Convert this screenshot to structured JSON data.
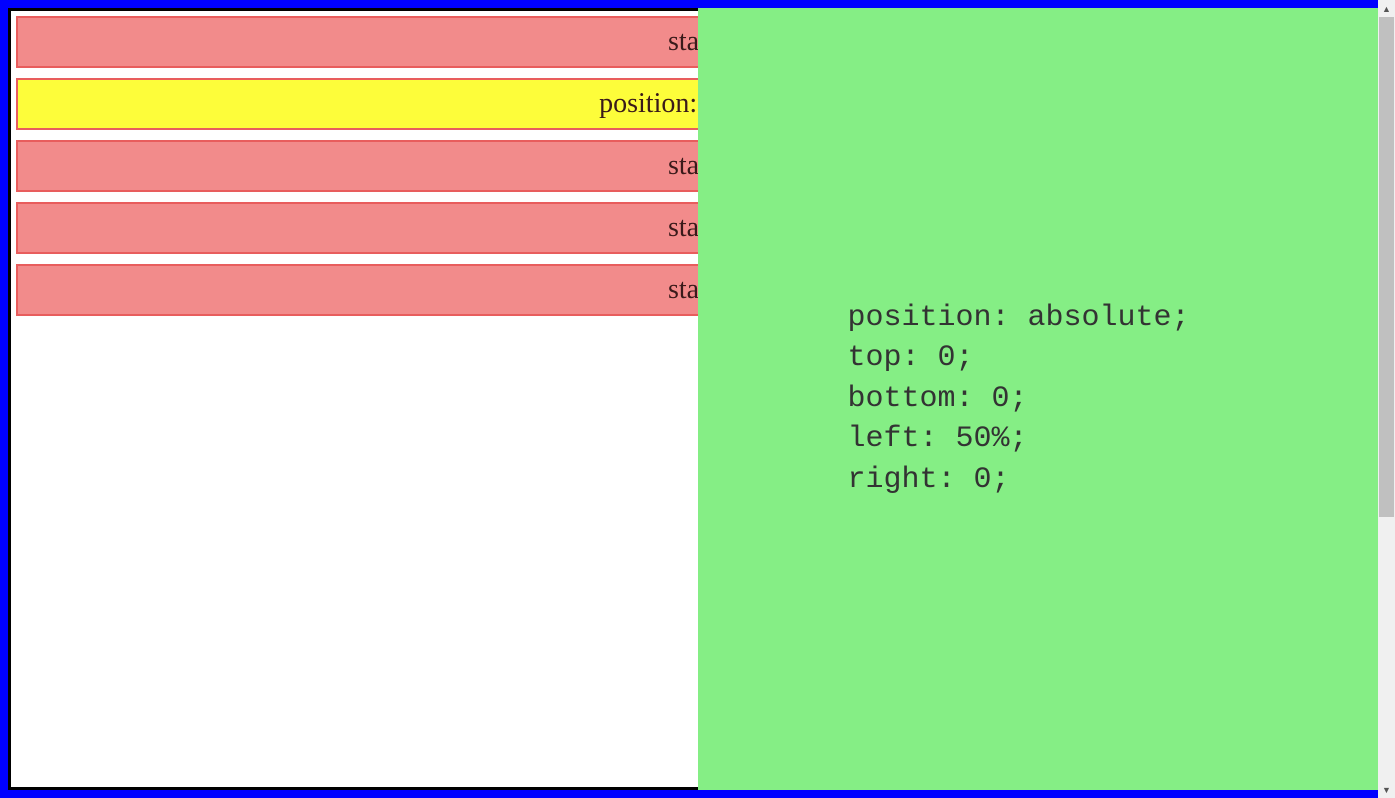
{
  "boxes": {
    "item0": "static",
    "item1": "position: relative;",
    "item2": "static",
    "item3": "static",
    "item4": "static"
  },
  "code": {
    "line0": "position: absolute;",
    "line1": "top: 0;",
    "line2": "bottom: 0;",
    "line3": "left: 50%;",
    "line4": "right: 0;"
  }
}
